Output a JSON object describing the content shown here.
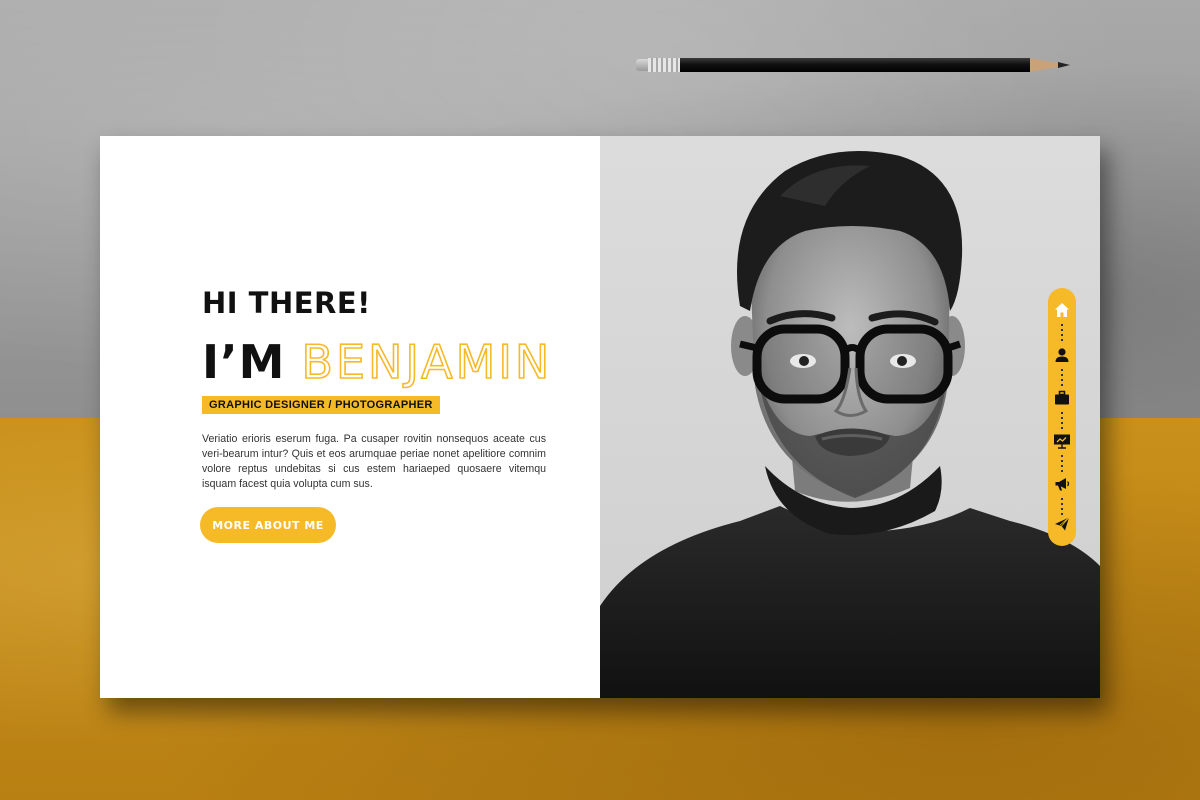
{
  "hero": {
    "greeting": "HI THERE!",
    "name_prefix": "I’M",
    "name": "BENJAMIN",
    "role": "GRAPHIC DESIGNER / PHOTOGRAPHER",
    "bio": "Veriatio erioris eserum fuga. Pa cusaper rovitin nonsequos aceate cus veri-bearum intur? Quis et eos arumquae periae nonet apelitiore comnim volore reptus undebitas si cus estem hariaeped quosaere vitemqu isquam facest quia volupta cum sus.",
    "cta_label": "MORE ABOUT ME"
  },
  "side_nav": {
    "items": [
      {
        "icon": "home-icon"
      },
      {
        "icon": "user-icon"
      },
      {
        "icon": "briefcase-icon"
      },
      {
        "icon": "presentation-icon"
      },
      {
        "icon": "megaphone-icon"
      },
      {
        "icon": "paper-plane-icon"
      }
    ]
  },
  "colors": {
    "accent": "#f6b928",
    "text_dark": "#111111",
    "background_bottom": "#c08a18",
    "background_top": "#9d9d9d"
  }
}
